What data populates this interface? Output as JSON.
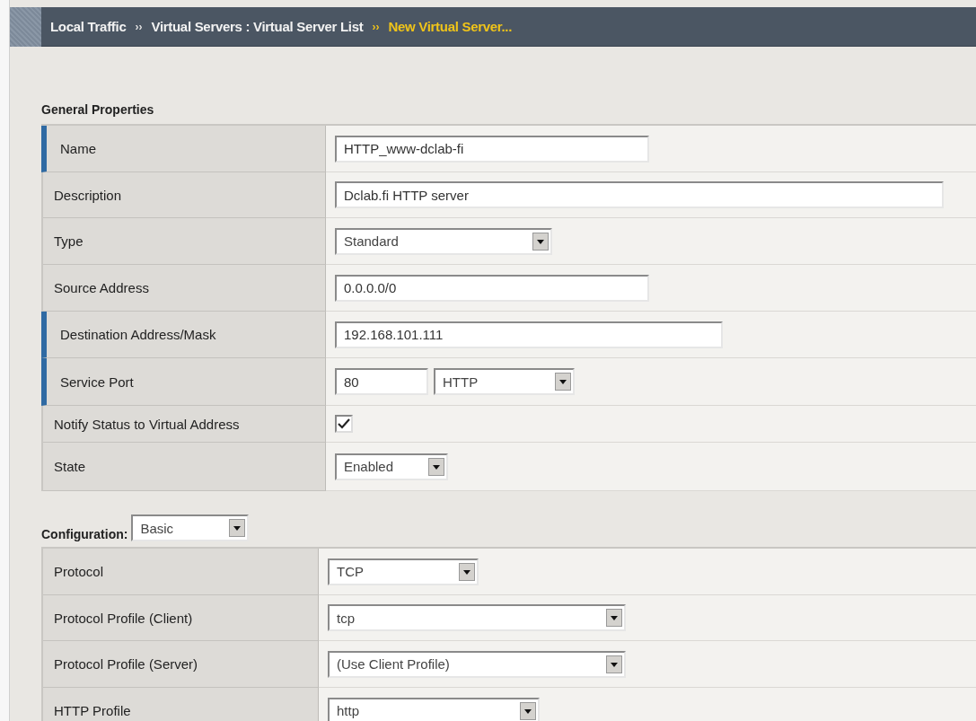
{
  "breadcrumb": [
    {
      "label": "Local Traffic",
      "current": false
    },
    {
      "label": "Virtual Servers : Virtual Server List",
      "current": false
    },
    {
      "label": "New Virtual Server...",
      "current": true
    }
  ],
  "separator": "››",
  "general_properties": {
    "title": "General Properties",
    "rows": [
      {
        "label": "Name",
        "required": true,
        "kind": "text",
        "value": "HTTP_www-dclab-fi"
      },
      {
        "label": "Description",
        "required": false,
        "kind": "text",
        "value": "Dclab.fi HTTP server"
      },
      {
        "label": "Type",
        "required": false,
        "kind": "select",
        "value": "Standard"
      },
      {
        "label": "Source Address",
        "required": false,
        "kind": "text",
        "value": "0.0.0.0/0"
      },
      {
        "label": "Destination Address/Mask",
        "required": true,
        "kind": "text",
        "value": "192.168.101.111"
      },
      {
        "label": "Service Port",
        "required": true,
        "kind": "port",
        "value": "80",
        "service": "HTTP"
      },
      {
        "label": "Notify Status to Virtual Address",
        "required": false,
        "kind": "checkbox",
        "checked": true
      },
      {
        "label": "State",
        "required": false,
        "kind": "select",
        "value": "Enabled"
      }
    ]
  },
  "configuration": {
    "label": "Configuration:",
    "value": "Basic",
    "rows": [
      {
        "label": "Protocol",
        "required": false,
        "kind": "select",
        "value": "TCP"
      },
      {
        "label": "Protocol Profile (Client)",
        "required": false,
        "kind": "select",
        "value": "tcp"
      },
      {
        "label": "Protocol Profile (Server)",
        "required": false,
        "kind": "select",
        "value": "(Use Client Profile)"
      },
      {
        "label": "HTTP Profile",
        "required": false,
        "kind": "select",
        "value": "http"
      }
    ]
  }
}
